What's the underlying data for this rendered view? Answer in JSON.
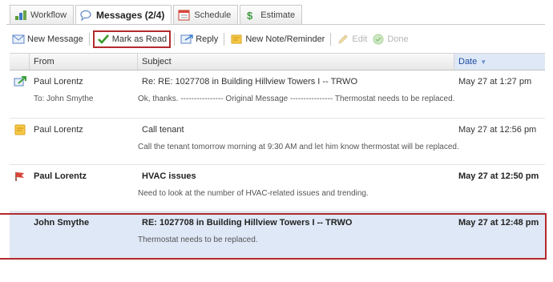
{
  "tabs": [
    {
      "label": "Workflow",
      "icon": "workflow-icon"
    },
    {
      "label": "Messages (2/4)",
      "icon": "messages-icon"
    },
    {
      "label": "Schedule",
      "icon": "calendar-icon"
    },
    {
      "label": "Estimate",
      "icon": "dollar-icon"
    }
  ],
  "toolbar": {
    "new_message": "New Message",
    "mark_as_read": "Mark as Read",
    "reply": "Reply",
    "new_note": "New Note/Reminder",
    "edit": "Edit",
    "done": "Done"
  },
  "grid": {
    "headers": {
      "from": "From",
      "subject": "Subject",
      "date": "Date"
    },
    "rows": [
      {
        "icon": "reply-arrow-icon",
        "from": "Paul Lorentz",
        "subject": "Re: RE: 1027708 in Building Hillview Towers I -- TRWO",
        "date": "May 27 at 1:27 pm",
        "to": "To: John Smythe",
        "preview": "Ok, thanks. ---------------- Original Message ---------------- Thermostat needs to be replaced."
      },
      {
        "icon": "note-icon",
        "from": "Paul Lorentz",
        "subject": "Call tenant",
        "date": "May 27 at 12:56 pm",
        "preview": "Call the tenant tomorrow morning at 9:30 AM and let him know thermostat will be replaced."
      },
      {
        "icon": "flag-icon",
        "from": "Paul Lorentz",
        "subject": "HVAC issues",
        "date": "May 27 at 12:50 pm",
        "preview": "Need to look at the number of HVAC-related issues and trending."
      },
      {
        "icon": "",
        "from": "John Smythe",
        "subject": "RE: 1027708 in Building Hillview Towers I -- TRWO",
        "date": "May 27 at 12:48 pm",
        "preview": "Thermostat needs to be replaced."
      }
    ]
  },
  "colors": {
    "highlight_red": "#b22a2e",
    "selection_blue": "#dfe8f6",
    "header_sort_blue": "#1f4ea1"
  }
}
